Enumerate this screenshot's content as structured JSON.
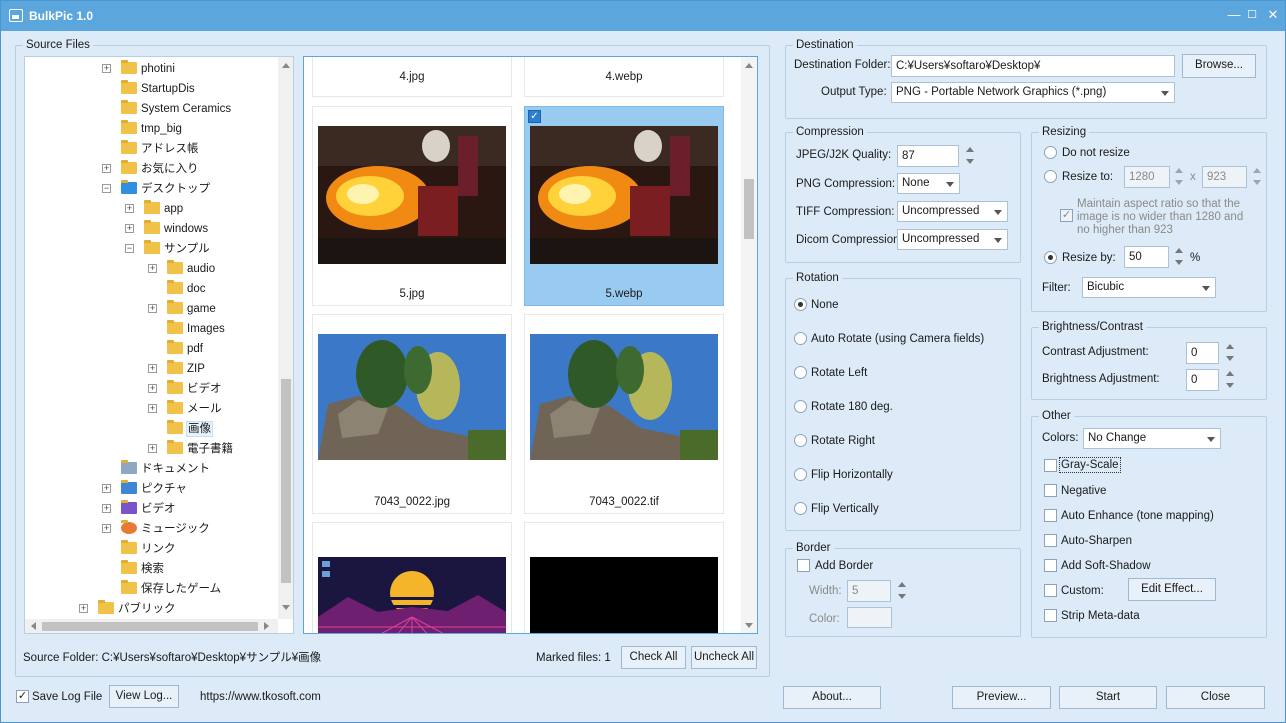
{
  "window": {
    "title": "BulkPic 1.0",
    "min_icon": "minimize-icon",
    "max_icon": "maximize-icon",
    "close_icon": "close-icon"
  },
  "source": {
    "group_label": "Source Files",
    "tree": [
      {
        "label": "photini",
        "indent": 0,
        "expander": "+",
        "icon": "folder-icon"
      },
      {
        "label": "StartupDis",
        "indent": 0,
        "expander": "",
        "icon": "folder-icon"
      },
      {
        "label": "System Ceramics",
        "indent": 0,
        "expander": "",
        "icon": "folder-icon"
      },
      {
        "label": "tmp_big",
        "indent": 0,
        "expander": "",
        "icon": "folder-icon"
      },
      {
        "label": "アドレス帳",
        "indent": 0,
        "expander": "",
        "icon": "folder-icon"
      },
      {
        "label": "お気に入り",
        "indent": 0,
        "expander": "+",
        "icon": "folder-icon"
      },
      {
        "label": "デスクトップ",
        "indent": 0,
        "expander": "−",
        "icon": "desktop-icon"
      },
      {
        "label": "app",
        "indent": 1,
        "expander": "+",
        "icon": "folder-icon"
      },
      {
        "label": "windows",
        "indent": 1,
        "expander": "+",
        "icon": "folder-icon"
      },
      {
        "label": "サンプル",
        "indent": 1,
        "expander": "−",
        "icon": "folder-icon"
      },
      {
        "label": "audio",
        "indent": 2,
        "expander": "+",
        "icon": "folder-icon"
      },
      {
        "label": "doc",
        "indent": 2,
        "expander": "",
        "icon": "folder-icon"
      },
      {
        "label": "game",
        "indent": 2,
        "expander": "+",
        "icon": "folder-icon"
      },
      {
        "label": "Images",
        "indent": 2,
        "expander": "",
        "icon": "folder-icon"
      },
      {
        "label": "pdf",
        "indent": 2,
        "expander": "",
        "icon": "folder-icon"
      },
      {
        "label": "ZIP",
        "indent": 2,
        "expander": "+",
        "icon": "folder-icon"
      },
      {
        "label": "ビデオ",
        "indent": 2,
        "expander": "+",
        "icon": "folder-icon"
      },
      {
        "label": "メール",
        "indent": 2,
        "expander": "+",
        "icon": "folder-icon"
      },
      {
        "label": "画像",
        "indent": 2,
        "expander": "",
        "icon": "folder-icon",
        "selected": true
      },
      {
        "label": "電子書籍",
        "indent": 2,
        "expander": "+",
        "icon": "folder-icon"
      },
      {
        "label": "ドキュメント",
        "indent": 0,
        "expander": "",
        "icon": "documents-icon"
      },
      {
        "label": "ピクチャ",
        "indent": 0,
        "expander": "+",
        "icon": "pictures-icon"
      },
      {
        "label": "ビデオ",
        "indent": 0,
        "expander": "+",
        "icon": "videos-icon"
      },
      {
        "label": "ミュージック",
        "indent": 0,
        "expander": "+",
        "icon": "music-icon"
      },
      {
        "label": "リンク",
        "indent": 0,
        "expander": "",
        "icon": "folder-icon"
      },
      {
        "label": "検索",
        "indent": 0,
        "expander": "",
        "icon": "folder-icon"
      },
      {
        "label": "保存したゲーム",
        "indent": 0,
        "expander": "",
        "icon": "folder-icon"
      },
      {
        "label": "パブリック",
        "indent": -1,
        "expander": "+",
        "icon": "folder-icon"
      }
    ],
    "files": [
      {
        "name": "4.jpg",
        "img": "none",
        "checked": false,
        "selected": false
      },
      {
        "name": "4.webp",
        "img": "none",
        "checked": false,
        "selected": false
      },
      {
        "name": "5.jpg",
        "img": "fire",
        "checked": false,
        "selected": false
      },
      {
        "name": "5.webp",
        "img": "fire",
        "checked": true,
        "selected": true
      },
      {
        "name": "7043_0022.jpg",
        "img": "rocks",
        "checked": false,
        "selected": false
      },
      {
        "name": "7043_0022.tif",
        "img": "rocks",
        "checked": false,
        "selected": false
      },
      {
        "name": "",
        "img": "synth",
        "checked": false,
        "selected": false
      },
      {
        "name": "",
        "img": "black",
        "checked": false,
        "selected": false
      }
    ],
    "folder_text": "Source Folder: C:¥Users¥softaro¥Desktop¥サンプル¥画像",
    "marked_text": "Marked files: 1",
    "check_all": "Check All",
    "uncheck_all": "Uncheck All"
  },
  "destination": {
    "group_label": "Destination",
    "folder_label": "Destination Folder:",
    "folder_value": "C:¥Users¥softaro¥Desktop¥",
    "browse": "Browse...",
    "type_label": "Output Type:",
    "type_value": "PNG - Portable Network Graphics (*.png)"
  },
  "compression": {
    "group_label": "Compression",
    "jpeg_label": "JPEG/J2K Quality:",
    "jpeg_value": "87",
    "png_label": "PNG Compression:",
    "png_value": "None",
    "tiff_label": "TIFF Compression:",
    "tiff_value": "Uncompressed",
    "dicom_label": "Dicom Compression:",
    "dicom_value": "Uncompressed"
  },
  "rotation": {
    "group_label": "Rotation",
    "options": [
      "None",
      "Auto Rotate (using Camera fields)",
      "Rotate Left",
      "Rotate 180 deg.",
      "Rotate Right",
      "Flip Horizontally",
      "Flip Vertically"
    ],
    "selected_index": 0
  },
  "border": {
    "group_label": "Border",
    "add_label": "Add Border",
    "width_label": "Width:",
    "width_value": "5",
    "color_label": "Color:"
  },
  "resizing": {
    "group_label": "Resizing",
    "no_resize": "Do not resize",
    "resize_to": "Resize to:",
    "to_w": "1280",
    "times": "x",
    "to_h": "923",
    "aspect_text": "Maintain aspect ratio so that the image is no wider than 1280 and no higher than 923",
    "resize_by": "Resize by:",
    "by_value": "50",
    "percent": "%",
    "filter_label": "Filter:",
    "filter_value": "Bicubic"
  },
  "brightness": {
    "group_label": "Brightness/Contrast",
    "contrast_label": "Contrast Adjustment:",
    "contrast_value": "0",
    "brightness_label": "Brightness Adjustment:",
    "brightness_value": "0"
  },
  "other": {
    "group_label": "Other",
    "colors_label": "Colors:",
    "colors_value": "No Change",
    "grayscale": "Gray-Scale",
    "negative": "Negative",
    "auto_enhance": "Auto Enhance (tone mapping)",
    "auto_sharpen": "Auto-Sharpen",
    "soft_shadow": "Add Soft-Shadow",
    "custom": "Custom:",
    "edit_effect": "Edit Effect...",
    "strip_meta": "Strip Meta-data"
  },
  "footer": {
    "save_log": "Save Log File",
    "view_log": "View Log...",
    "url": "https://www.tkosoft.com",
    "about": "About...",
    "preview": "Preview...",
    "start": "Start",
    "close": "Close"
  }
}
